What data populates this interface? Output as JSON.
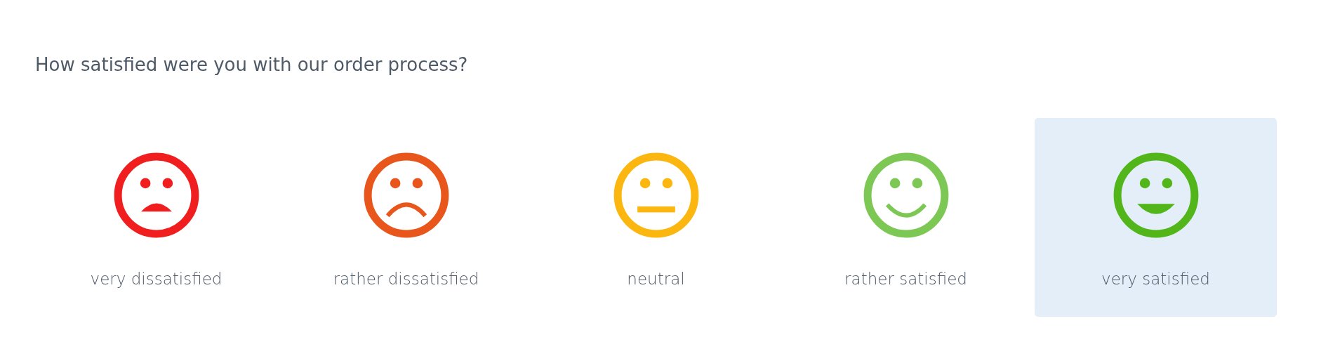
{
  "question": "How satisfied were you with our order process?",
  "options": [
    {
      "label": "very dissatisfied",
      "kind": "big-frown",
      "color": "#f01e1e",
      "selected": false
    },
    {
      "label": "rather dissatisfied",
      "kind": "frown",
      "color": "#e8561c",
      "selected": false
    },
    {
      "label": "neutral",
      "kind": "flat",
      "color": "#fbb710",
      "selected": false
    },
    {
      "label": "rather satisfied",
      "kind": "smile",
      "color": "#7dc855",
      "selected": false
    },
    {
      "label": "very satisfied",
      "kind": "big-smile",
      "color": "#52b51a",
      "selected": true
    }
  ]
}
